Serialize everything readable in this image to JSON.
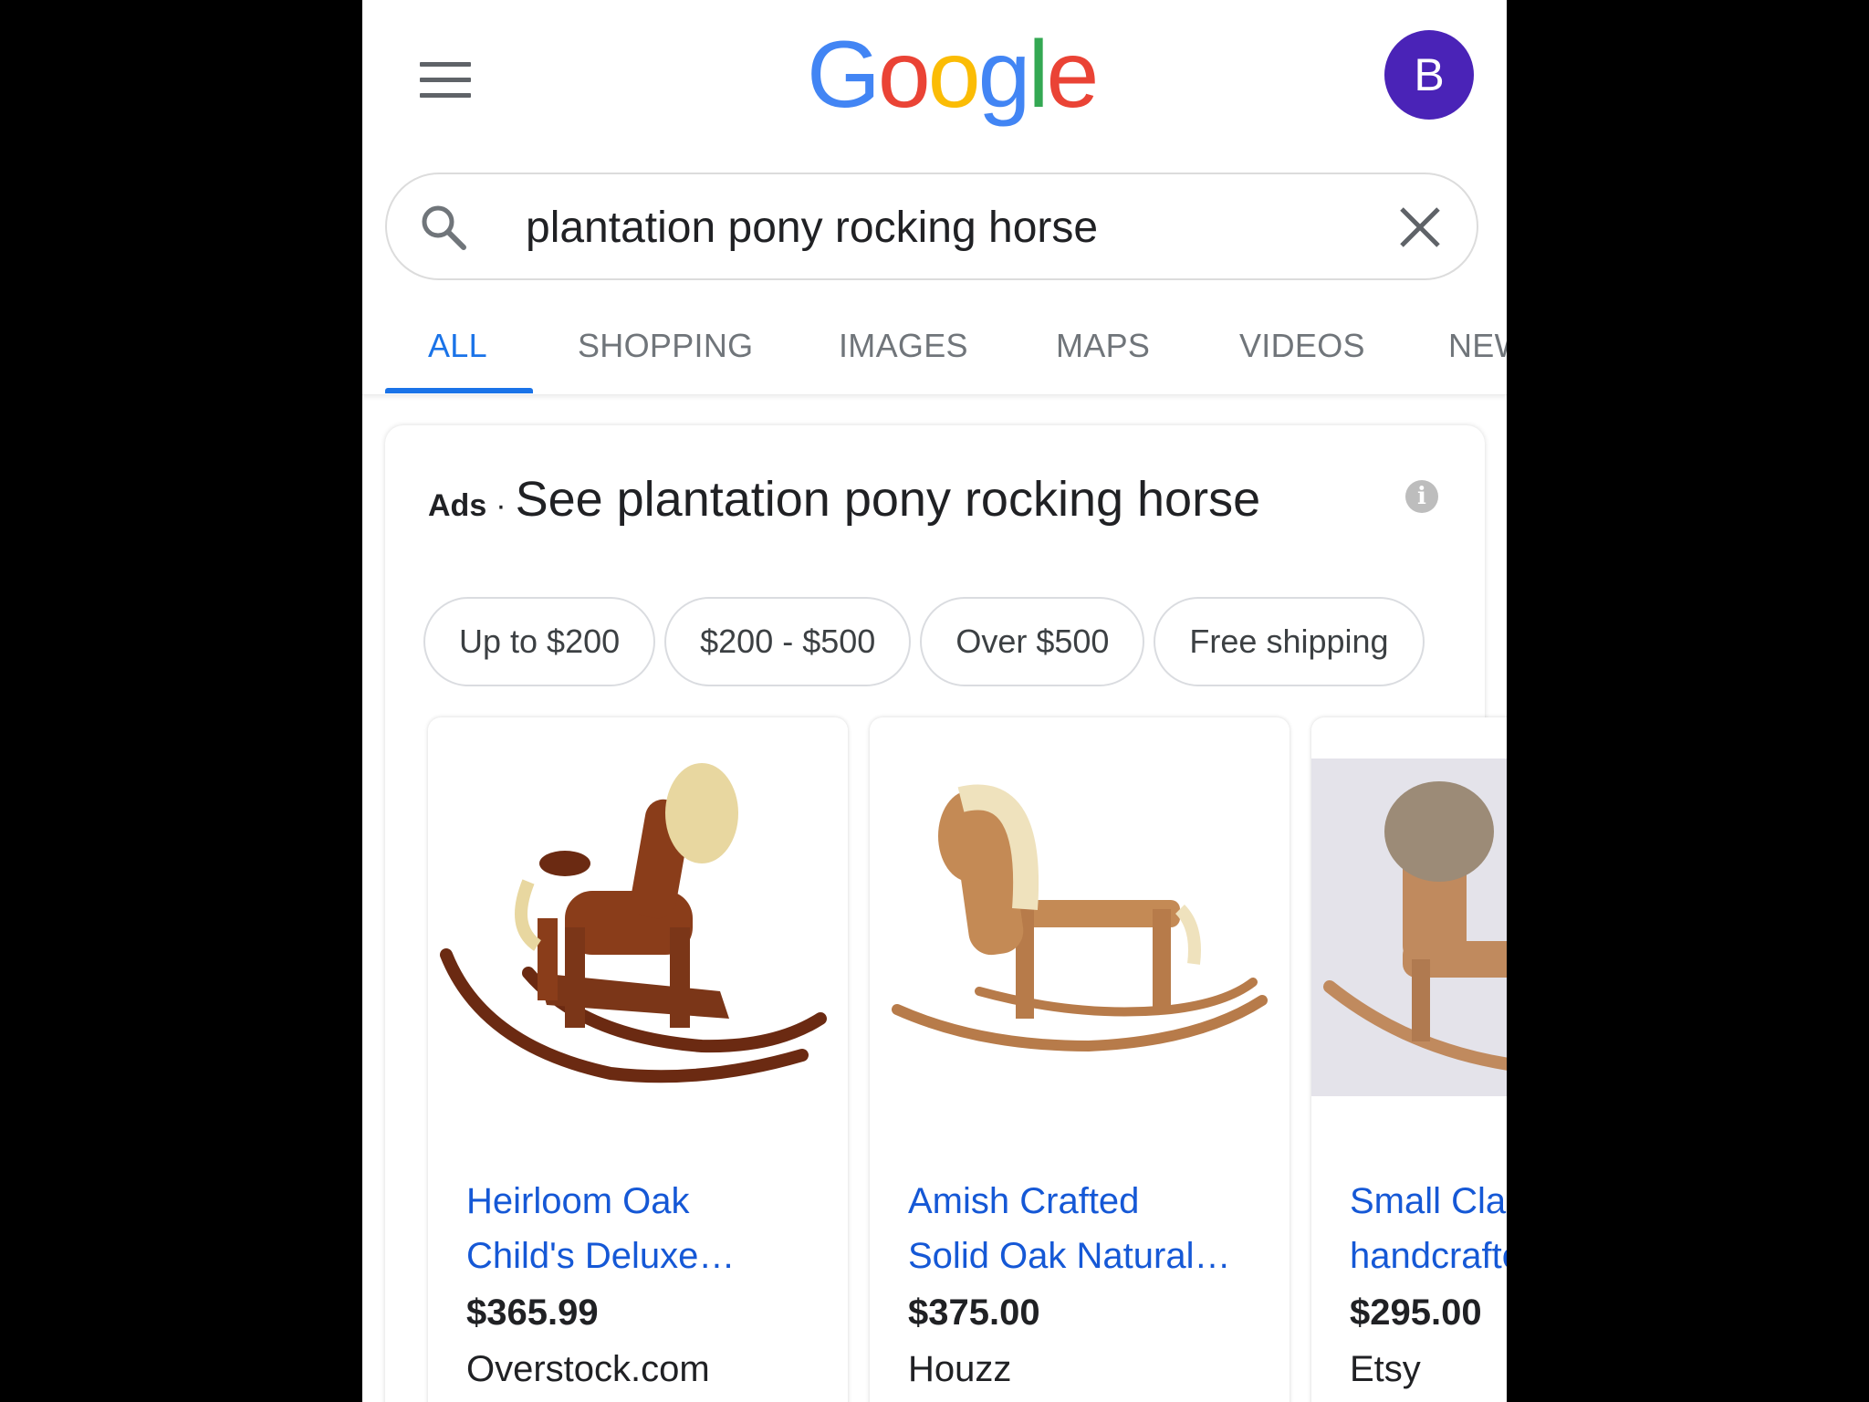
{
  "header": {
    "logo_letters": [
      "G",
      "o",
      "o",
      "g",
      "l",
      "e"
    ],
    "avatar_initial": "B",
    "avatar_color": "#4a23b7"
  },
  "search": {
    "query": "plantation pony rocking horse"
  },
  "tabs": [
    {
      "label": "ALL",
      "active": true
    },
    {
      "label": "SHOPPING",
      "active": false
    },
    {
      "label": "IMAGES",
      "active": false
    },
    {
      "label": "MAPS",
      "active": false
    },
    {
      "label": "VIDEOS",
      "active": false
    },
    {
      "label": "NEWS",
      "active": false
    }
  ],
  "ads": {
    "label": "Ads",
    "separator": "·",
    "title": "See plantation pony rocking horse",
    "info_icon": "i",
    "chips": [
      "Up to $200",
      "$200 - $500",
      "Over $500",
      "Free shipping"
    ],
    "products": [
      {
        "title": "Heirloom Oak\nChild's Deluxe…",
        "price": "$365.99",
        "store": "Overstock.com"
      },
      {
        "title": "Amish Crafted\nSolid Oak Natural…",
        "price": "$375.00",
        "store": "Houzz"
      },
      {
        "title": "Small Classic\nhandcrafted",
        "price": "$295.00",
        "store": "Etsy"
      }
    ]
  },
  "colors": {
    "accent": "#1a73e8",
    "link": "#1558d6"
  }
}
